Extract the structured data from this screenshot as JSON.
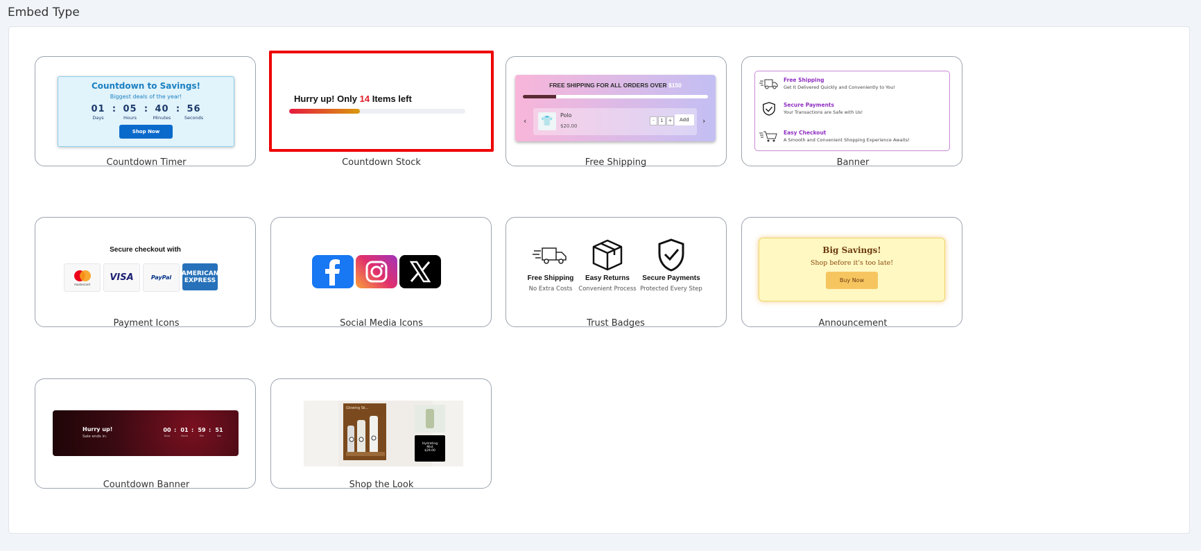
{
  "page": {
    "title": "Embed Type"
  },
  "cards": [
    {
      "label": "Countdown Timer",
      "selected": false
    },
    {
      "label": "Countdown Stock",
      "selected": true
    },
    {
      "label": "Free Shipping",
      "selected": false
    },
    {
      "label": "Banner",
      "selected": false
    },
    {
      "label": "Payment Icons",
      "selected": false
    },
    {
      "label": "Social Media Icons",
      "selected": false
    },
    {
      "label": "Trust Badges",
      "selected": false
    },
    {
      "label": "Announcement",
      "selected": false
    },
    {
      "label": "Countdown Banner",
      "selected": false
    },
    {
      "label": "Shop the Look",
      "selected": false
    }
  ],
  "countdown_timer": {
    "title": "Countdown to Savings!",
    "subtitle": "Biggest deals of the year!",
    "units": [
      {
        "value": "01",
        "label": "Days"
      },
      {
        "value": "05",
        "label": "Hours"
      },
      {
        "value": "40",
        "label": "Minutes"
      },
      {
        "value": "56",
        "label": "Seconds"
      }
    ],
    "button": "Shop Now",
    "accent_color": "#0a6acb"
  },
  "countdown_stock": {
    "prefix": "Hurry up! Only",
    "count": "14",
    "suffix": "Items left",
    "progress": 0.4
  },
  "free_shipping": {
    "title": "FREE SHIPPING FOR ALL ORDERS OVER",
    "amount": "$150",
    "progress": 0.18,
    "product_name": "Polo",
    "product_price": "$20.00",
    "qty_minus": "-",
    "qty": "1",
    "qty_plus": "+",
    "add_button": "Add",
    "prev_arrow": "‹",
    "next_arrow": "›"
  },
  "banner": {
    "items": [
      {
        "title": "Free Shipping",
        "desc": "Get It Delivered Quickly and Conveniently to You!",
        "icon": "truck-icon"
      },
      {
        "title": "Secure Payments",
        "desc": "Your Transactions are Safe with Us!",
        "icon": "shield-check-icon"
      },
      {
        "title": "Easy Checkout",
        "desc": "A Smooth and Convenient Shopping Experience Awaits!",
        "icon": "cart-icon"
      }
    ]
  },
  "payment_icons": {
    "title": "Secure checkout with",
    "mastercard_label": "mastercard",
    "visa": "VISA",
    "paypal": "PayPal",
    "amex_line1": "AMERICAN",
    "amex_line2": "EXPRESS"
  },
  "social_icons": [
    "facebook-icon",
    "instagram-icon",
    "x-icon"
  ],
  "trust_badges": {
    "items": [
      {
        "title": "Free Shipping",
        "sub": "No Extra Costs",
        "icon": "truck-icon"
      },
      {
        "title": "Easy Returns",
        "sub": "Convenient Process",
        "icon": "box-icon"
      },
      {
        "title": "Secure Payments",
        "sub": "Protected Every Step",
        "icon": "shield-check-icon"
      }
    ]
  },
  "announcement": {
    "title": "Big Savings!",
    "subtitle": "Shop before it's too late!",
    "button": "Buy Now"
  },
  "countdown_banner": {
    "heading": "Hurry up!",
    "sub": "Sale ends in:",
    "units": [
      {
        "value": "00",
        "label": "Days"
      },
      {
        "value": "01",
        "label": "Hours"
      },
      {
        "value": "59",
        "label": "Min"
      },
      {
        "value": "51",
        "label": "Sec"
      }
    ]
  },
  "shop_the_look": {
    "panel_text": "Glowing Sk...",
    "tag_line1": "Hydrating",
    "tag_line2": "Mist",
    "tag_price": "$29.00"
  }
}
